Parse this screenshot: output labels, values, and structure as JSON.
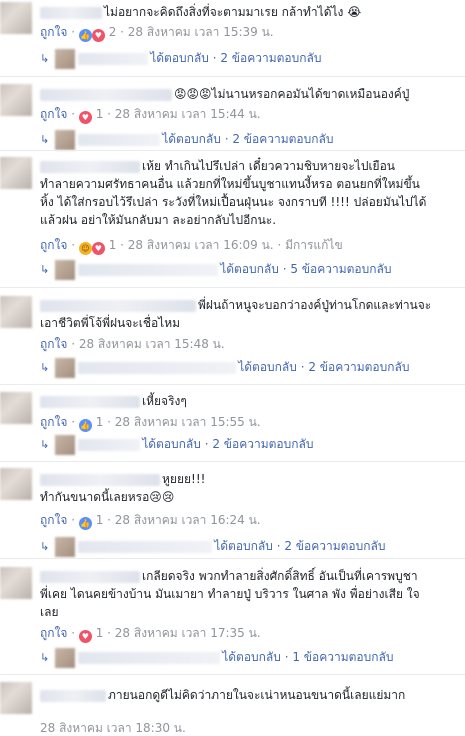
{
  "comments": [
    {
      "text": "ไม่อยากจะคิดถึงสิ่งที่จะตามมาเรย กล้าทำได้ไง 😭",
      "like": "ถูกใจ",
      "reactions": "2",
      "time": "28 สิงหาคม เวลา 15:39 น.",
      "replies": "ได้ตอบกลับ · 2 ข้อความตอบกลับ"
    },
    {
      "text": "😡😡😡ไม่นานหรอกคอมันได้ขาดเหมือนองค์ปู่",
      "like": "ถูกใจ",
      "reactions": "1",
      "time": "28 สิงหาคม เวลา 15:44 น.",
      "replies": "ได้ตอบกลับ · 2 ข้อความตอบกลับ"
    },
    {
      "text1": "เห้ย ทำเกินไปรึเปล่า เดี๋ยวความชิบหายจะไปเยือน",
      "text2": "ทำลายความศรัทธาคนอื่น แล้วยกที่ใหม่ขึ้นบูชาแทนงี้หรอ ตอนยกที่ใหม่ขึ้น",
      "text3": "หิ้ง ได้ใส่กรอบไว้รึเปล่า ระวังที่ใหม่เปื้อนฝุ่นนะ จงกราบที !!!! ปล่อยมันไปได้",
      "text4": "แล้วฝน อย่าให้มันกลับมา ละอย่ากลับไปอีกนะ.",
      "like": "ถูกใจ",
      "reactions": "1",
      "time": "28 สิงหาคม เวลา 16:09 น. · มีการแก้ไข",
      "replies": "ได้ตอบกลับ · 5 ข้อความตอบกลับ"
    },
    {
      "text1": "พี่ฝนถ้าหนูจะบอกว่าองค์ปู่ท่านโกดและท่านจะ",
      "text2": "เอาชีวิตพี่โจ้พี่ฝนจะเชื่อไหม",
      "like": "ถูกใจ",
      "time": "28 สิงหาคม เวลา 15:48 น.",
      "replies": "ได้ตอบกลับ · 2 ข้อความตอบกลับ"
    },
    {
      "text": "เหี้ยจริงๆ",
      "like": "ถูกใจ",
      "reactions": "1",
      "time": "28 สิงหาคม เวลา 15:55 น.",
      "replies": "ได้ตอบกลับ · 2 ข้อความตอบกลับ"
    },
    {
      "text1": "หูยยย!!!",
      "text2": "ทำกันขนาดนี้เลยหรอ😢😢",
      "like": "ถูกใจ",
      "reactions": "1",
      "time": "28 สิงหาคม เวลา 16:24 น.",
      "replies": "ได้ตอบกลับ · 2 ข้อความตอบกลับ"
    },
    {
      "text1": "เกลียดจริง พวกทำลายสิ่งศักดิ์สิทธิ์ อันเป็นที่เคารพบูชา",
      "text2": "พี่เคย ไดนคยข้างบ้าน มันเมายา ทำลายปู่ บริวาร ในศาล พัง พื่อย่างเสีย ใจ",
      "text3": "เลย",
      "like": "ถูกใจ",
      "reactions": "1",
      "time": "28 สิงหาคม เวลา 17:35 น.",
      "replies": "ได้ตอบกลับ · 1 ข้อความตอบกลับ"
    },
    {
      "text": "ภายนอกดูดีไม่คิดว่าภายในจะเน่าหนอนขนาดนี้เลยแย่มาก",
      "time": "28 สิงหาคม เวลา 18:30 น."
    }
  ]
}
